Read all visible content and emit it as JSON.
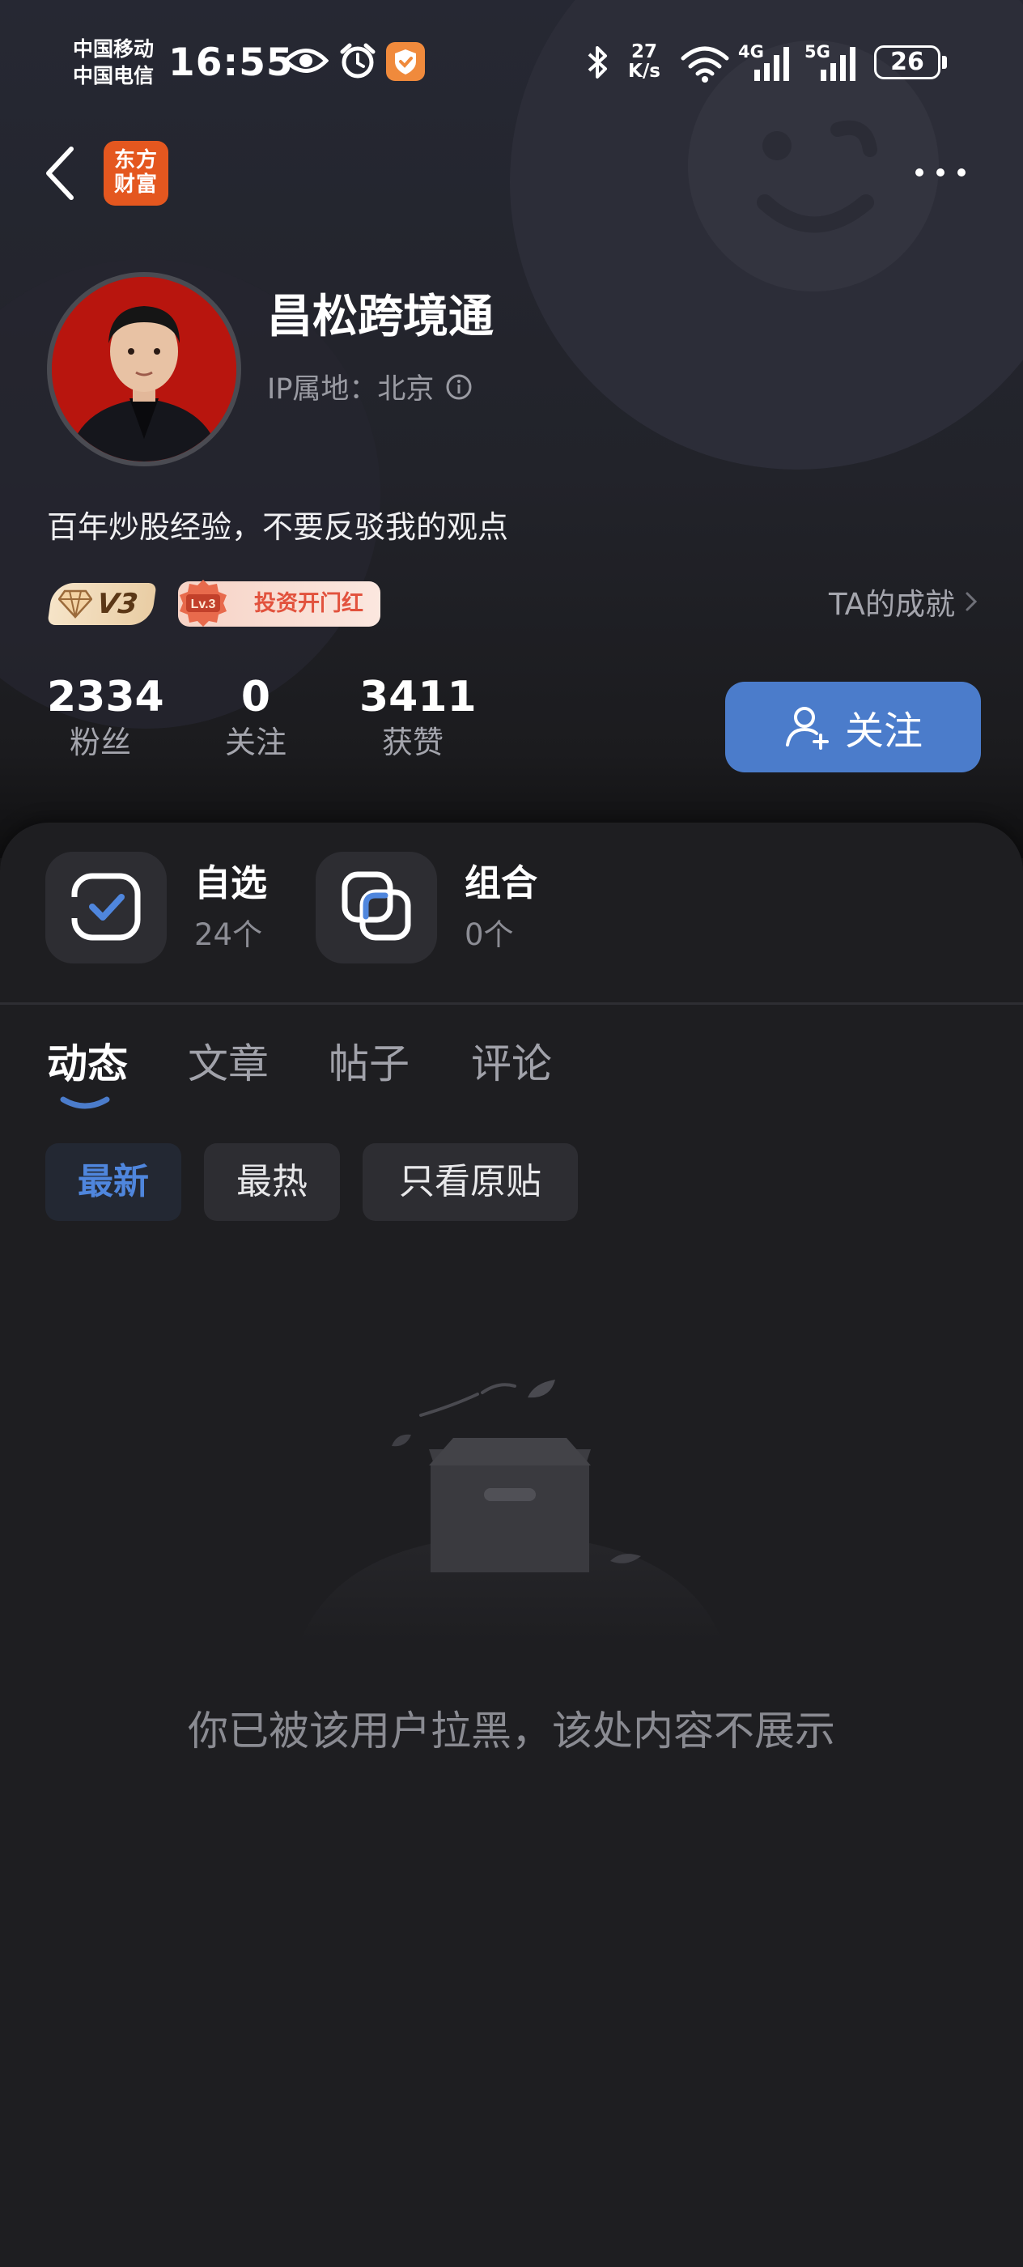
{
  "status_bar": {
    "carrier_1": "中国移动",
    "carrier_2": "中国电信",
    "time": "16:55",
    "net_speed_value": "27",
    "net_speed_unit": "K/s",
    "signal_1_label": "4G",
    "signal_2_label": "5G",
    "battery": "26"
  },
  "nav": {
    "app_logo_line1": "东方",
    "app_logo_line2": "财富"
  },
  "profile": {
    "name": "昌松跨境通",
    "ip_location": "IP属地：北京",
    "bio": "百年炒股经验，不要反驳我的观点",
    "badge_level": "V3",
    "badge_invest_level": "Lv.3",
    "badge_invest_label": "投资开门红",
    "achievement_link": "TA的成就"
  },
  "stats": [
    {
      "value": "2334",
      "label": "粉丝"
    },
    {
      "value": "0",
      "label": "关注"
    },
    {
      "value": "3411",
      "label": "获赞"
    }
  ],
  "follow_button": "关注",
  "quick_links": [
    {
      "title": "自选",
      "count": "24个",
      "icon": "watchlist-check-icon"
    },
    {
      "title": "组合",
      "count": "0个",
      "icon": "portfolio-overlap-icon"
    }
  ],
  "tabs": [
    {
      "label": "动态",
      "active": true
    },
    {
      "label": "文章",
      "active": false
    },
    {
      "label": "帖子",
      "active": false
    },
    {
      "label": "评论",
      "active": false
    }
  ],
  "filters": [
    {
      "label": "最新",
      "active": true
    },
    {
      "label": "最热",
      "active": false
    },
    {
      "label": "只看原贴",
      "active": false
    }
  ],
  "empty_state": {
    "message": "你已被该用户拉黑，该处内容不展示",
    "illustration": "empty-box-icon"
  },
  "colors": {
    "accent_blue": "#4b7ccb",
    "app_logo_orange": "#e4571f",
    "background": "#19191b"
  }
}
